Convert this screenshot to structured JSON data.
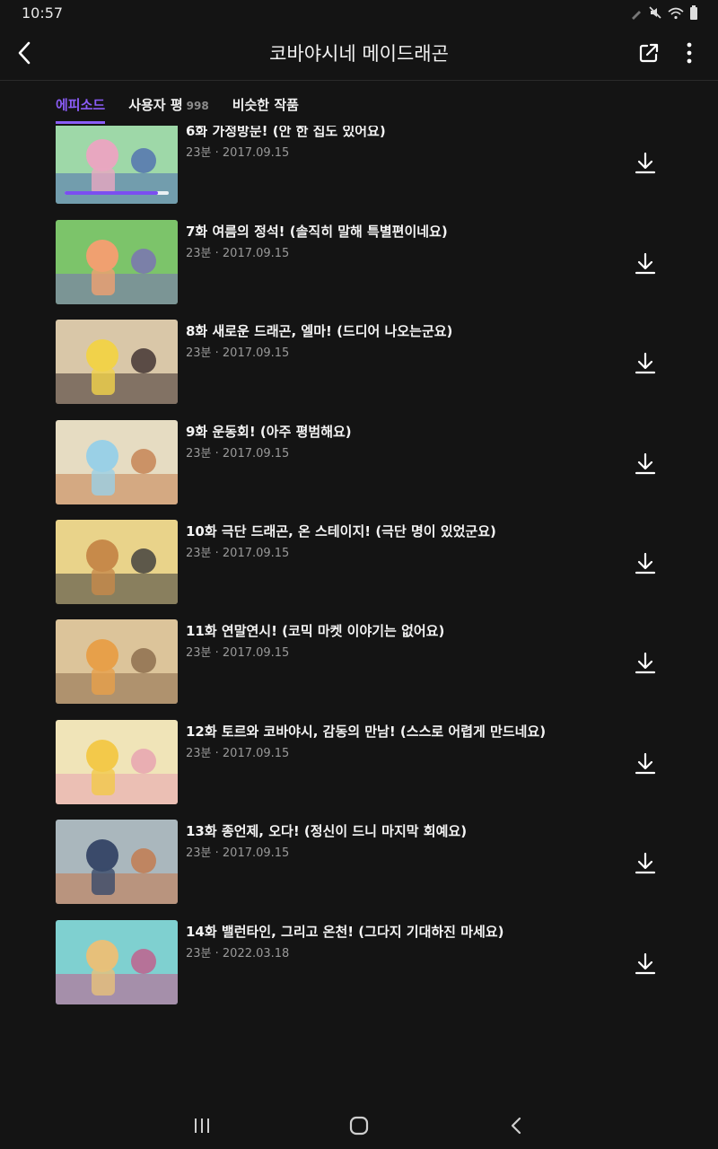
{
  "status_bar": {
    "time": "10:57"
  },
  "header": {
    "title": "코바야시네 메이드래곤"
  },
  "tabs": [
    {
      "label": "에피소드",
      "count": ""
    },
    {
      "label": "사용자 평",
      "count": "998"
    },
    {
      "label": "비슷한 작품",
      "count": ""
    }
  ],
  "colors": {
    "accent": "#8a5cf6",
    "background": "#141414",
    "meta_text": "#9a9a9a"
  },
  "episodes": [
    {
      "title": "",
      "meta": "23분 · 2017.09.15",
      "progress": 0.9,
      "palette": [
        "#e9e3d6",
        "#d97a6b",
        "#3b3140"
      ]
    },
    {
      "title": "6화 가정방문! (안 한 집도 있어요)",
      "meta": "23분 · 2017.09.15",
      "progress": 0.9,
      "palette": [
        "#9ed8a8",
        "#e8a7c0",
        "#4f6eb0"
      ]
    },
    {
      "title": "7화 여름의 정석! (솔직히 말해 특별편이네요)",
      "meta": "23분 · 2017.09.15",
      "progress": 0,
      "palette": [
        "#7cc46a",
        "#f0a070",
        "#7a6fb8"
      ]
    },
    {
      "title": "8화 새로운 드래곤, 엘마! (드디어 나오는군요)",
      "meta": "23분 · 2017.09.15",
      "progress": 0,
      "palette": [
        "#d9c7a8",
        "#f1d24a",
        "#3a2c2c"
      ]
    },
    {
      "title": "9화 운동회! (아주 평범해요)",
      "meta": "23분 · 2017.09.15",
      "progress": 0,
      "palette": [
        "#e6dcc2",
        "#9ad0e6",
        "#c4804f"
      ]
    },
    {
      "title": "10화 극단 드래곤, 온 스테이지! (극단 명이 있었군요)",
      "meta": "23분 · 2017.09.15",
      "progress": 0,
      "palette": [
        "#e9d38a",
        "#c78a4a",
        "#3a3a3a"
      ]
    },
    {
      "title": "11화 연말연시! (코믹 마켓 이야기는 없어요)",
      "meta": "23분 · 2017.09.15",
      "progress": 0,
      "palette": [
        "#dcc49a",
        "#e7a04a",
        "#8a6a4a"
      ]
    },
    {
      "title": "12화 토르와 코바야시, 감동의 만남! (스스로 어렵게 만드네요)",
      "meta": "23분 · 2017.09.15",
      "progress": 0,
      "palette": [
        "#f0e4b8",
        "#f3c94a",
        "#e7a0b0"
      ]
    },
    {
      "title": "13화 종언제, 오다! (정신이 드니 마지막 회예요)",
      "meta": "23분 · 2017.09.15",
      "progress": 0,
      "palette": [
        "#aab7bd",
        "#3a4a6a",
        "#c4784a"
      ]
    },
    {
      "title": "14화 밸런타인, 그리고 온천! (그다지 기대하진 마세요)",
      "meta": "23분 · 2022.03.18",
      "progress": 0,
      "palette": [
        "#7fd0d0",
        "#e7c07a",
        "#c45a8a"
      ]
    }
  ],
  "icons": {
    "back": "back-arrow-icon",
    "share": "share-icon",
    "more": "more-vert-icon",
    "download": "download-icon"
  }
}
